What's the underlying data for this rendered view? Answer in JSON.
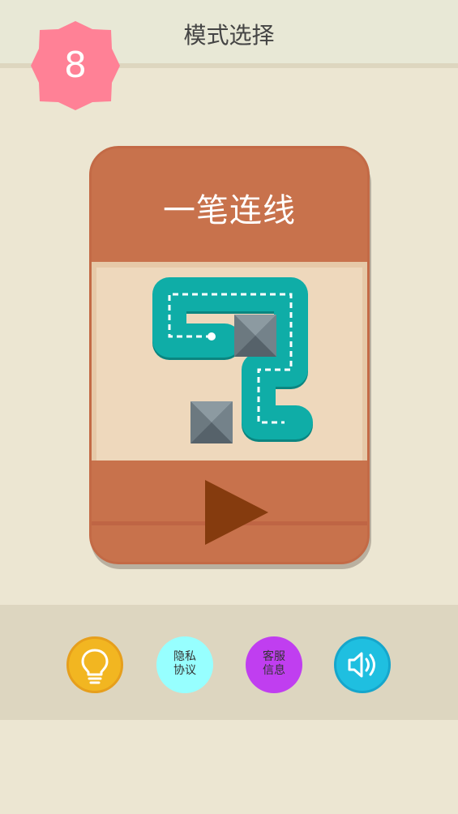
{
  "header": {
    "title": "模式选择"
  },
  "badge": {
    "value": "8",
    "color": "#ff8196"
  },
  "card": {
    "title": "一笔连线",
    "play_icon": "play-icon"
  },
  "bottom_bar": {
    "hint_icon": "lightbulb-icon",
    "privacy_label_line1": "隐私",
    "privacy_label_line2": "协议",
    "service_label_line1": "客服",
    "service_label_line2": "信息",
    "sound_icon": "speaker-icon"
  },
  "colors": {
    "background": "#ece6d2",
    "card": "#c8724c",
    "path": "#0fada7",
    "hint_button": "#f2b621",
    "privacy_button": "#97ffff",
    "service_button": "#c03ef0",
    "sound_button": "#1fbfe0"
  }
}
